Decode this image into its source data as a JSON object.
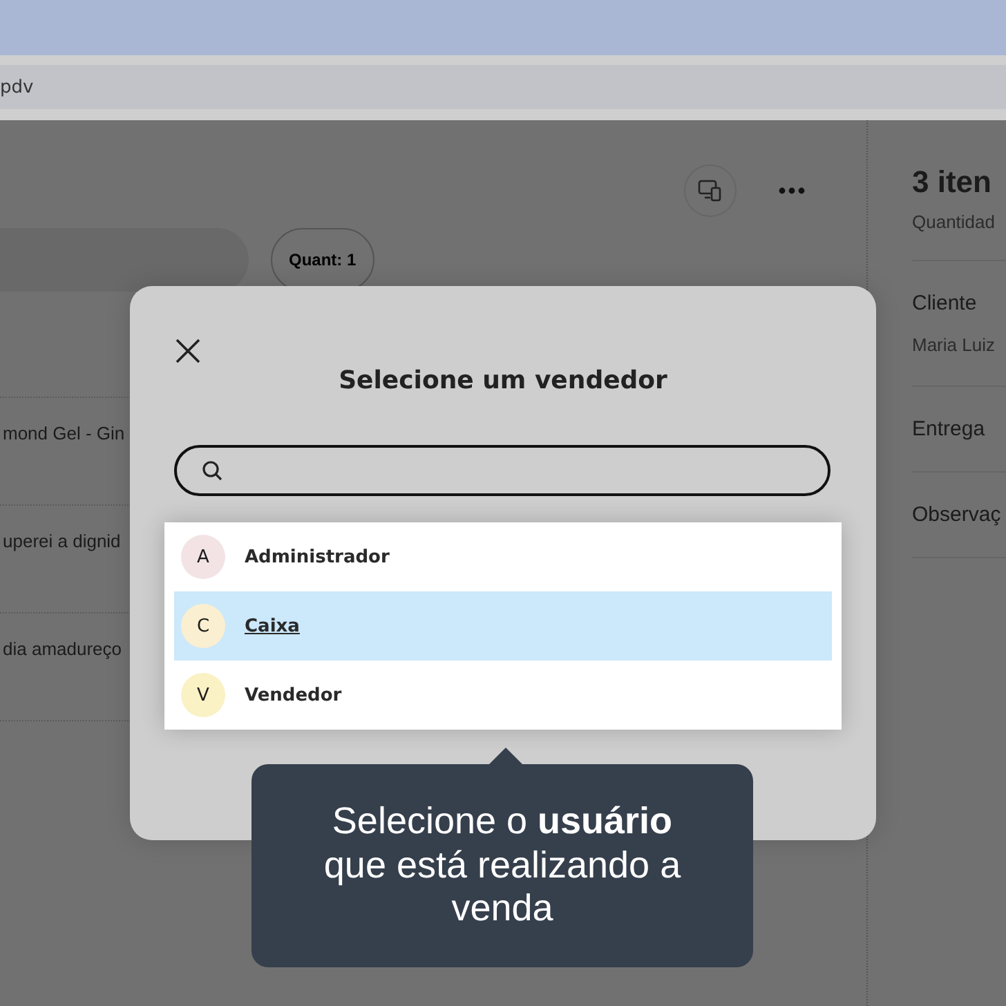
{
  "browser": {
    "address": "pdv"
  },
  "background": {
    "quantity_label": "Quant:",
    "quantity_value": "1",
    "products": [
      "mond Gel - Gin",
      "uperei a dignid",
      "dia amadureço"
    ]
  },
  "summary": {
    "title": "3 iten",
    "subtitle": "Quantidad",
    "sections": [
      {
        "label": "Cliente",
        "value": "Maria Luiz"
      },
      {
        "label": "Entrega"
      },
      {
        "label": "Observaç"
      }
    ]
  },
  "modal": {
    "title": "Selecione um vendedor",
    "options": [
      {
        "initial": "A",
        "name": "Administrador",
        "selected": false,
        "color": "#f3e3e5"
      },
      {
        "initial": "C",
        "name": "Caixa",
        "selected": true,
        "color": "#faefd0"
      },
      {
        "initial": "V",
        "name": "Vendedor",
        "selected": false,
        "color": "#faf1c4"
      }
    ]
  },
  "tooltip": {
    "text": "Selecione o **usuário** que está realizando a venda"
  }
}
